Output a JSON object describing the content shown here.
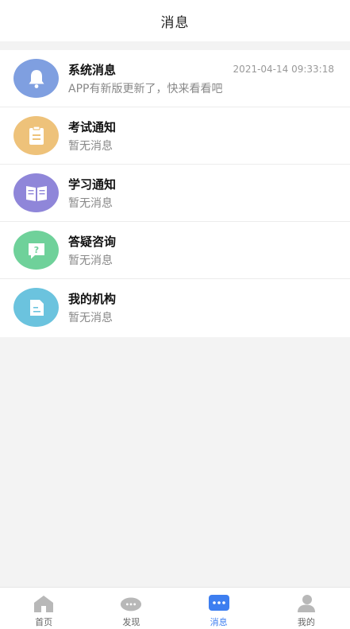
{
  "header": {
    "title": "消息"
  },
  "messages": [
    {
      "title": "系统消息",
      "subtitle": "APP有新版更新了，快来看看吧",
      "time": "2021-04-14 09:33:18",
      "icon": "bell-icon",
      "color": "#7f9fe0"
    },
    {
      "title": "考试通知",
      "subtitle": "暂无消息",
      "icon": "clipboard-icon",
      "color": "#eec27a"
    },
    {
      "title": "学习通知",
      "subtitle": "暂无消息",
      "icon": "book-icon",
      "color": "#8f86d9"
    },
    {
      "title": "答疑咨询",
      "subtitle": "暂无消息",
      "icon": "question-chat-icon",
      "color": "#6fd19a"
    },
    {
      "title": "我的机构",
      "subtitle": "暂无消息",
      "icon": "document-icon",
      "color": "#6bc3de"
    }
  ],
  "tabbar": {
    "active": "消息",
    "items": [
      {
        "label": "首页",
        "icon": "home-icon"
      },
      {
        "label": "发现",
        "icon": "discover-icon"
      },
      {
        "label": "消息",
        "icon": "message-icon"
      },
      {
        "label": "我的",
        "icon": "profile-icon"
      }
    ]
  },
  "colors": {
    "accent": "#3d7ef0",
    "background": "#f3f3f3"
  }
}
